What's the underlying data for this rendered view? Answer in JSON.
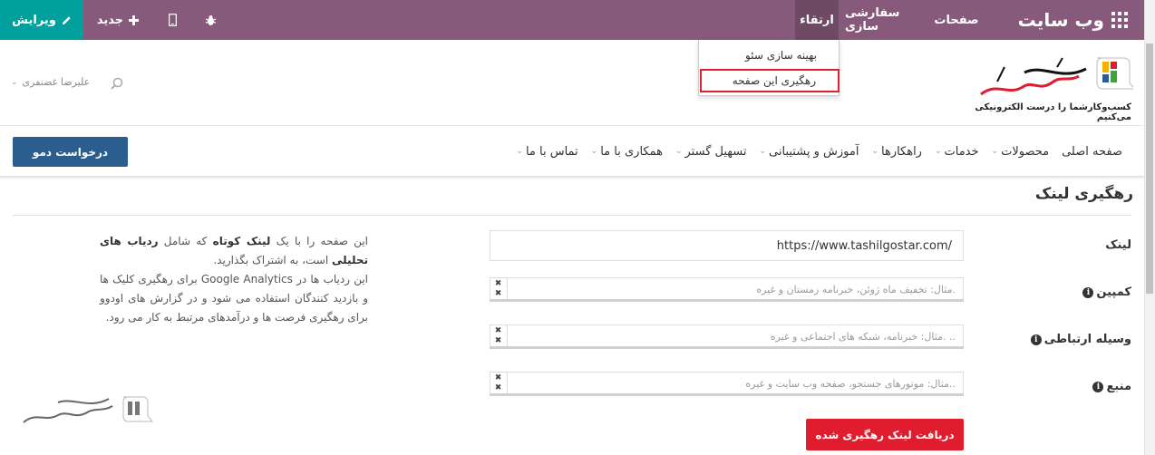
{
  "topbar": {
    "edit_label": "ویرایش",
    "new_label": "جدید",
    "menu_promote": "ارتقاء",
    "menu_customize": "سفارشی سازی",
    "menu_pages": "صفحات",
    "brand": "وب سایت"
  },
  "dropdown": {
    "items": [
      {
        "label": "بهینه سازی سئو"
      },
      {
        "label": "رهگیری این صفحه"
      }
    ]
  },
  "header": {
    "user_name": "علیرضا غضنفری",
    "logo_tagline": "کسب‌وکار‌شما را درست الکترونیکی‌ می‌کنیم",
    "demo_button": "درخواست دمو",
    "nav": [
      {
        "label": "صفحه اصلی",
        "has_caret": false
      },
      {
        "label": "محصولات",
        "has_caret": true
      },
      {
        "label": "خدمات",
        "has_caret": true
      },
      {
        "label": "راهکارها",
        "has_caret": true
      },
      {
        "label": "آموزش و پشتیبانی",
        "has_caret": true
      },
      {
        "label": "تسهیل گستر",
        "has_caret": true
      },
      {
        "label": "همکاری با ما",
        "has_caret": true
      },
      {
        "label": "تماس با ما",
        "has_caret": true
      }
    ]
  },
  "page": {
    "title": "رهگیری لینک",
    "help_p1_a": "این صفحه را با یک ",
    "help_p1_b": "لینک کوتاه",
    "help_p1_c": " که شامل ",
    "help_p1_d": "ردیاب های تحلیلی",
    "help_p1_e": " است، به اشتراک بگذارید.",
    "help_p2": "این ردیاب ها در Google Analytics برای رهگیری کلیک ها و بازدید کنندگان استفاده می شود و در گزارش های اودوو برای رهگیری فرصت ها و درآمدهای مرتبط به کار می رود.",
    "fields": {
      "link_label": "لینک",
      "link_value": "https://www.tashilgostar.com/",
      "campaign_label": "کمپین",
      "campaign_placeholder": "مثال: تخفیف ماه ژوئن، خبرنامه زمستان و غیره.",
      "medium_label": "وسیله ارتباطی",
      "medium_placeholder": "مثال: خبرنامه، شبکه های اجتماعی و غیره. ..",
      "source_label": "منبع",
      "source_placeholder": "مثال: موتورهای جستجو، صفحه وب سایت و غیره.."
    },
    "submit_label": "دریافت لینک رهگیری شده"
  },
  "colors": {
    "topbar": "#875a7b",
    "edit": "#00a09d",
    "demo": "#2c5d8f",
    "submit": "#e01c2f",
    "highlight": "#e0202f"
  }
}
